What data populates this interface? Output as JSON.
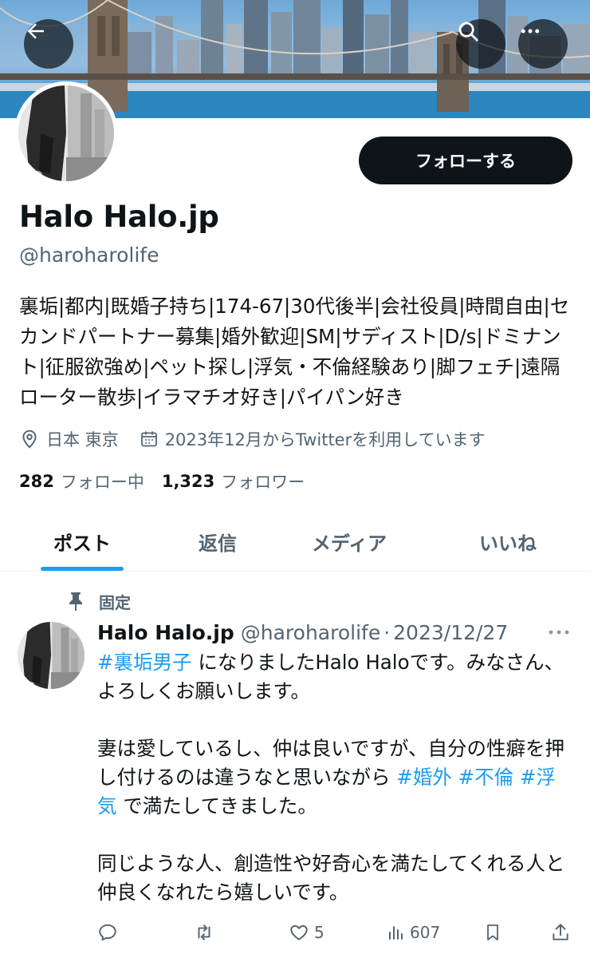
{
  "header": {
    "back_icon": "arrow-left-icon",
    "search_icon": "search-icon",
    "more_icon": "more-horizontal-icon"
  },
  "profile": {
    "display_name": "Halo Halo.jp",
    "handle": "@haroharolife",
    "follow_label": "フォローする",
    "bio": "裏垢|都内|既婚子持ち|174-67|30代後半|会社役員|時間自由|セカンドパートナー募集|婚外歓迎|SM|サディスト|D/s|ドミナント|征服欲強め|ペット探し|浮気・不倫経験あり|脚フェチ|遠隔ローター散歩|イラマチオ好き|パイパン好き",
    "location": "日本 東京",
    "joined": "2023年12月からTwitterを利用しています",
    "following_count": "282",
    "following_label": "フォロー中",
    "followers_count": "1,323",
    "followers_label": "フォロワー"
  },
  "tabs": [
    {
      "label": "ポスト",
      "active": true
    },
    {
      "label": "返信",
      "active": false
    },
    {
      "label": "メディア",
      "active": false
    },
    {
      "label": "いいね",
      "active": false
    }
  ],
  "post": {
    "pinned_label": "固定",
    "author_name": "Halo Halo.jp",
    "author_handle": "@haroharolife",
    "separator": "·",
    "date": "2023/12/27",
    "line1_tag": "#裏垢男子",
    "line1_text": " になりましたHalo Haloです。みなさん、よろしくお願いします。",
    "para2_text": "妻は愛しているし、仲は良いですが、自分の性癖を押し付けるのは違うなと思いながら ",
    "para2_tag1": "#婚外",
    "para2_space1": " ",
    "para2_tag2": "#不倫",
    "para2_space2": " ",
    "para2_tag3": "#浮気",
    "para2_end": " で満たしてきました。",
    "para3_text": "同じような人、創造性や好奇心を満たしてくれる人と仲良くなれたら嬉しいです。",
    "likes": "5",
    "views": "607"
  },
  "colors": {
    "accent": "#1d9bf0",
    "text_primary": "#0f1419",
    "text_secondary": "#536471",
    "follow_button": "#0f1419"
  }
}
